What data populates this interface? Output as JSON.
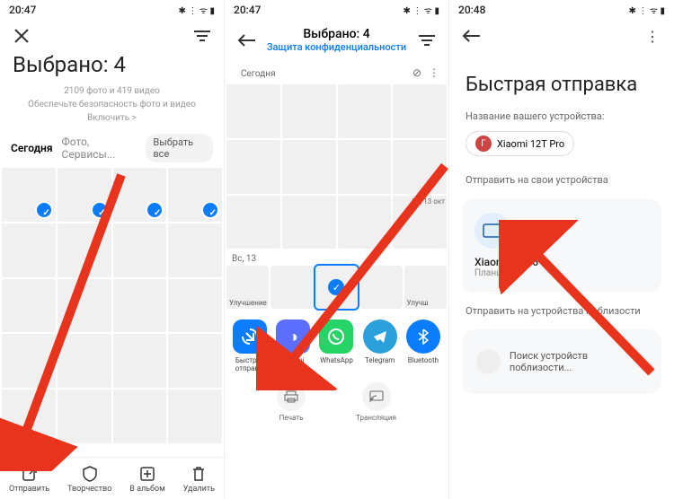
{
  "status": {
    "time_left": "20:47",
    "time_right": "20:48",
    "indicators": "✱ ⋮ ᯤ ▮"
  },
  "panel1": {
    "title": "Выбрано: 4",
    "stats": "2109 фото и 419 видео",
    "hint": "Обеспечьте безопасность фото и видео Включить >",
    "tabs": {
      "active": "Сегодня",
      "inactive": "Фото, Сервисы...",
      "selectAll": "Выбрать все"
    },
    "bottom": [
      {
        "icon": "share",
        "label": "Отправить"
      },
      {
        "icon": "shield",
        "label": "Творчество"
      },
      {
        "icon": "add",
        "label": "В альбом"
      },
      {
        "icon": "trash",
        "label": "Удалить"
      }
    ]
  },
  "panel2": {
    "title": "Выбрано: 4",
    "link": "Защита конфиденциальности",
    "dateSection": "Сегодня",
    "dateSun": "Вс, 13 окт",
    "dateSun2": "Вс, 13",
    "chips": {
      "enhance": "Улучшение",
      "enhance2": "Улучш"
    },
    "share": [
      {
        "label": "Быстрая отправ...",
        "bg": "#0a7cff"
      },
      {
        "label": "Xiaomi Share",
        "bg": "#5b6eff"
      },
      {
        "label": "WhatsApp",
        "bg": "#25d366"
      },
      {
        "label": "Telegram",
        "bg": "#2aa1da"
      },
      {
        "label": "Bluetooth",
        "bg": "#0a7cff"
      }
    ],
    "actions": [
      {
        "icon": "print",
        "label": "Печать"
      },
      {
        "icon": "cast",
        "label": "Трансляция"
      }
    ]
  },
  "panel3": {
    "title": "Быстрая отправка",
    "deviceNameLabel": "Название вашего устройства:",
    "deviceName": "Xiaomi 12T Pro",
    "sendOwnLabel": "Отправить на свои устройства",
    "target": {
      "name": "Xiaomi Pad 6",
      "type": "Планшет"
    },
    "nearbyLabel": "Отправить на устройства поблизости",
    "searching": "Поиск устройств поблизости..."
  }
}
